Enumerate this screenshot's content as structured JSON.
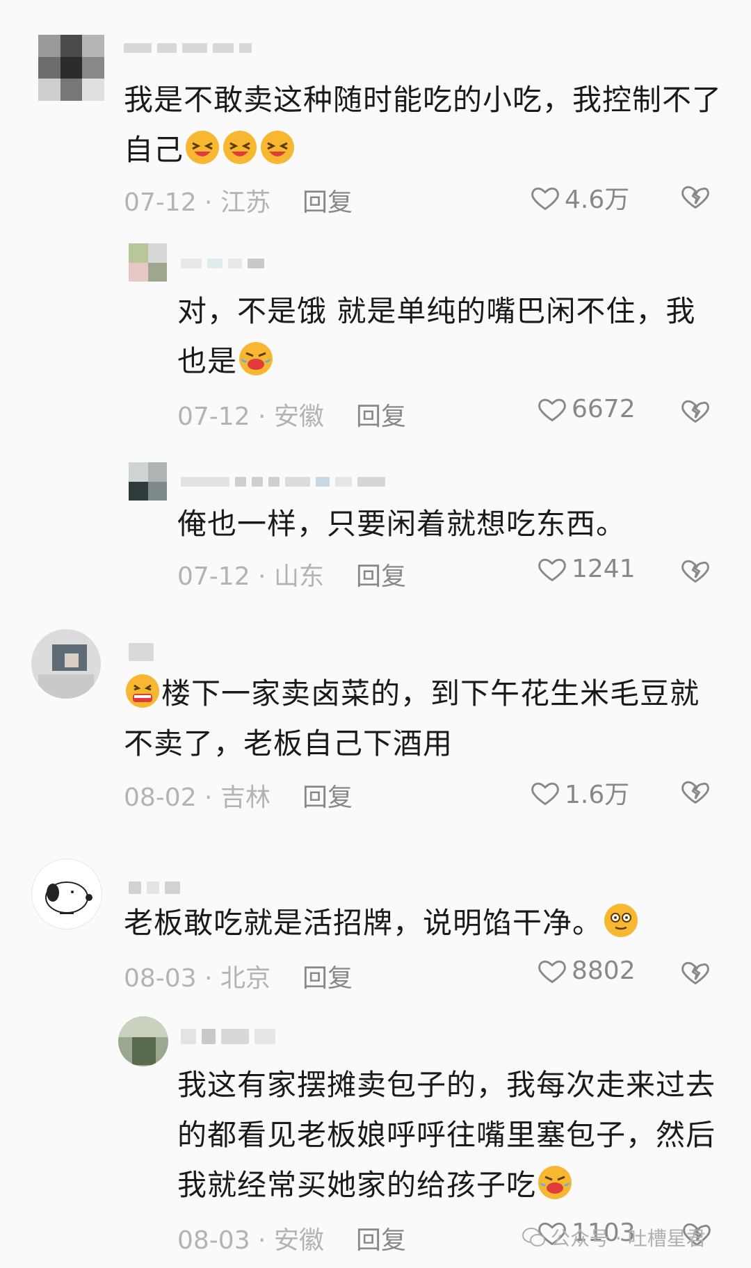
{
  "comments": [
    {
      "text": "我是不敢卖这种随时能吃的小吃，我控制不了自己",
      "line1": "我是不敢卖这种随时能吃的小吃，我控制不了",
      "line2": "自己",
      "emoji": "grinning-squint-emoji",
      "date_location": "07-12 · 江苏",
      "reply": "回复",
      "likes": "4.6万"
    },
    {
      "line1": "对，不是饿 就是单纯的嘴巴闲不住，我",
      "line2": "也是",
      "emoji": "rofl-emoji",
      "date_location": "07-12 · 安徽",
      "reply": "回复",
      "likes": "6672"
    },
    {
      "line1": "俺也一样，只要闲着就想吃东西。",
      "date_location": "07-12 · 山东",
      "reply": "回复",
      "likes": "1241"
    },
    {
      "line1": "楼下一家卖卤菜的，到下午花生米毛豆就",
      "line2": "不卖了，老板自己下酒用",
      "emoji": "drooling-emoji",
      "date_location": "08-02 · 吉林",
      "reply": "回复",
      "likes": "1.6万"
    },
    {
      "line1": "老板敢吃就是活招牌，说明馅干净。",
      "emoji": "dizzy-face-emoji",
      "date_location": "08-03 · 北京",
      "reply": "回复",
      "likes": "8802"
    },
    {
      "line1": "我这有家摆摊卖包子的，我每次走来过去",
      "line2": "的都看见老板娘呼呼往嘴里塞包子，然后",
      "line3": "我就经常买她家的给孩子吃",
      "emoji": "rofl-emoji",
      "date_location": "08-03 · 安徽",
      "reply": "回复",
      "likes": "1103"
    }
  ],
  "watermark": {
    "text": "公众号 · 吐槽星君",
    "icon": "wechat-icon"
  },
  "colors": {
    "background": "#fafafa",
    "text": "#1a1a1a",
    "meta": "#b3b3b3",
    "reply": "#888888",
    "emoji": "#f7b731"
  }
}
